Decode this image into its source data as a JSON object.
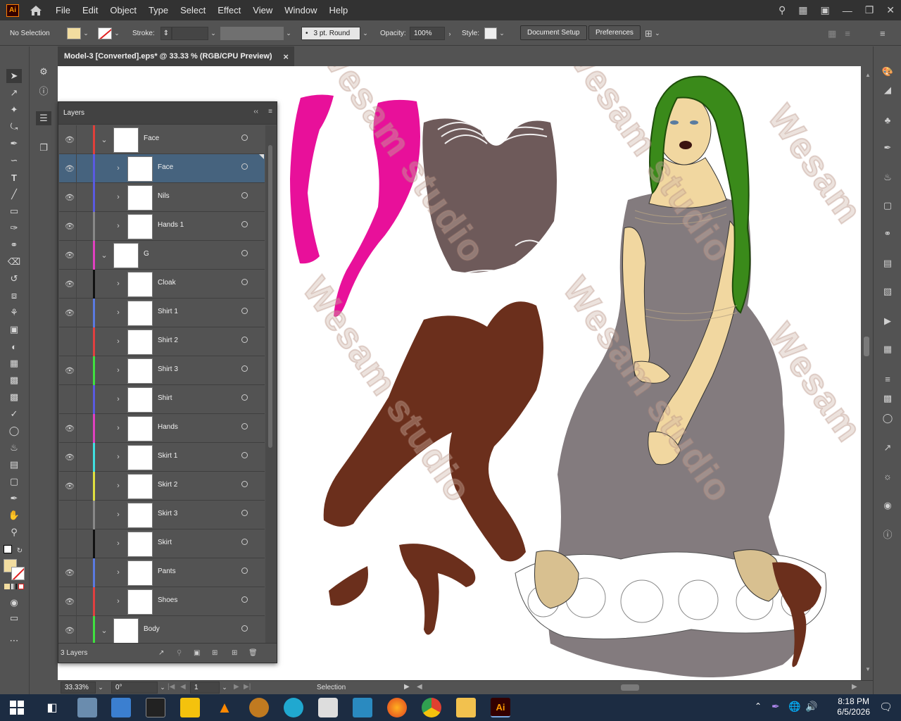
{
  "app": {
    "logo": "Ai",
    "menus": [
      "File",
      "Edit",
      "Object",
      "Type",
      "Select",
      "Effect",
      "View",
      "Window",
      "Help"
    ]
  },
  "control": {
    "selection": "No Selection",
    "stroke_label": "Stroke:",
    "brush": "3 pt. Round",
    "opacity_label": "Opacity:",
    "opacity_value": "100%",
    "style_label": "Style:",
    "doc_setup": "Document Setup",
    "preferences": "Preferences"
  },
  "document": {
    "tab_title": "Model-3 [Converted].eps* @ 33.33 % (RGB/CPU Preview)",
    "close": "×"
  },
  "layers_panel": {
    "title": "Layers",
    "count": "3 Layers",
    "rows": [
      {
        "name": "Face",
        "level": 0,
        "color": "#e0403a",
        "expanded": true,
        "visible": true,
        "selected": false
      },
      {
        "name": "Face",
        "level": 1,
        "color": "#5a5ae0",
        "expanded": false,
        "visible": true,
        "selected": true
      },
      {
        "name": "Nils",
        "level": 1,
        "color": "#5a5ae0",
        "expanded": false,
        "visible": true,
        "selected": false
      },
      {
        "name": "Hands 1",
        "level": 1,
        "color": "#888888",
        "expanded": false,
        "visible": true,
        "selected": false
      },
      {
        "name": "G",
        "level": 0,
        "color": "#e040c0",
        "expanded": true,
        "visible": true,
        "selected": false
      },
      {
        "name": "Cloak",
        "level": 1,
        "color": "#111111",
        "expanded": false,
        "visible": true,
        "selected": false
      },
      {
        "name": "Shirt 1",
        "level": 1,
        "color": "#5a7ae0",
        "expanded": false,
        "visible": true,
        "selected": false
      },
      {
        "name": "Shirt 2",
        "level": 1,
        "color": "#e04040",
        "expanded": false,
        "visible": false,
        "selected": false
      },
      {
        "name": "Shirt 3",
        "level": 1,
        "color": "#40e040",
        "expanded": false,
        "visible": true,
        "selected": false
      },
      {
        "name": "Shirt",
        "level": 1,
        "color": "#5a5ae0",
        "expanded": false,
        "visible": false,
        "selected": false
      },
      {
        "name": "Hands",
        "level": 1,
        "color": "#e040c0",
        "expanded": false,
        "visible": true,
        "selected": false
      },
      {
        "name": "Skirt 1",
        "level": 1,
        "color": "#40e0e0",
        "expanded": false,
        "visible": true,
        "selected": false
      },
      {
        "name": "Skirt 2",
        "level": 1,
        "color": "#e0e040",
        "expanded": false,
        "visible": true,
        "selected": false
      },
      {
        "name": "Skirt 3",
        "level": 1,
        "color": "#888888",
        "expanded": false,
        "visible": false,
        "selected": false
      },
      {
        "name": "Skirt",
        "level": 1,
        "color": "#111111",
        "expanded": false,
        "visible": false,
        "selected": false
      },
      {
        "name": "Pants",
        "level": 1,
        "color": "#5a7ae0",
        "expanded": false,
        "visible": true,
        "selected": false
      },
      {
        "name": "Shoes",
        "level": 1,
        "color": "#e04040",
        "expanded": false,
        "visible": true,
        "selected": false
      },
      {
        "name": "Body",
        "level": 0,
        "color": "#40e040",
        "expanded": true,
        "visible": true,
        "selected": false
      }
    ]
  },
  "status": {
    "zoom": "33.33%",
    "rotation": "0°",
    "artboard": "1",
    "tool": "Selection"
  },
  "watermark": {
    "line1": "Wesam",
    "line2": "studio"
  },
  "taskbar": {
    "time": "8:18 PM",
    "date": "6/5/2026"
  },
  "colors": {
    "fill": "#f2dda0",
    "selected_row": "#46637e",
    "accent": "#ff9a00"
  }
}
